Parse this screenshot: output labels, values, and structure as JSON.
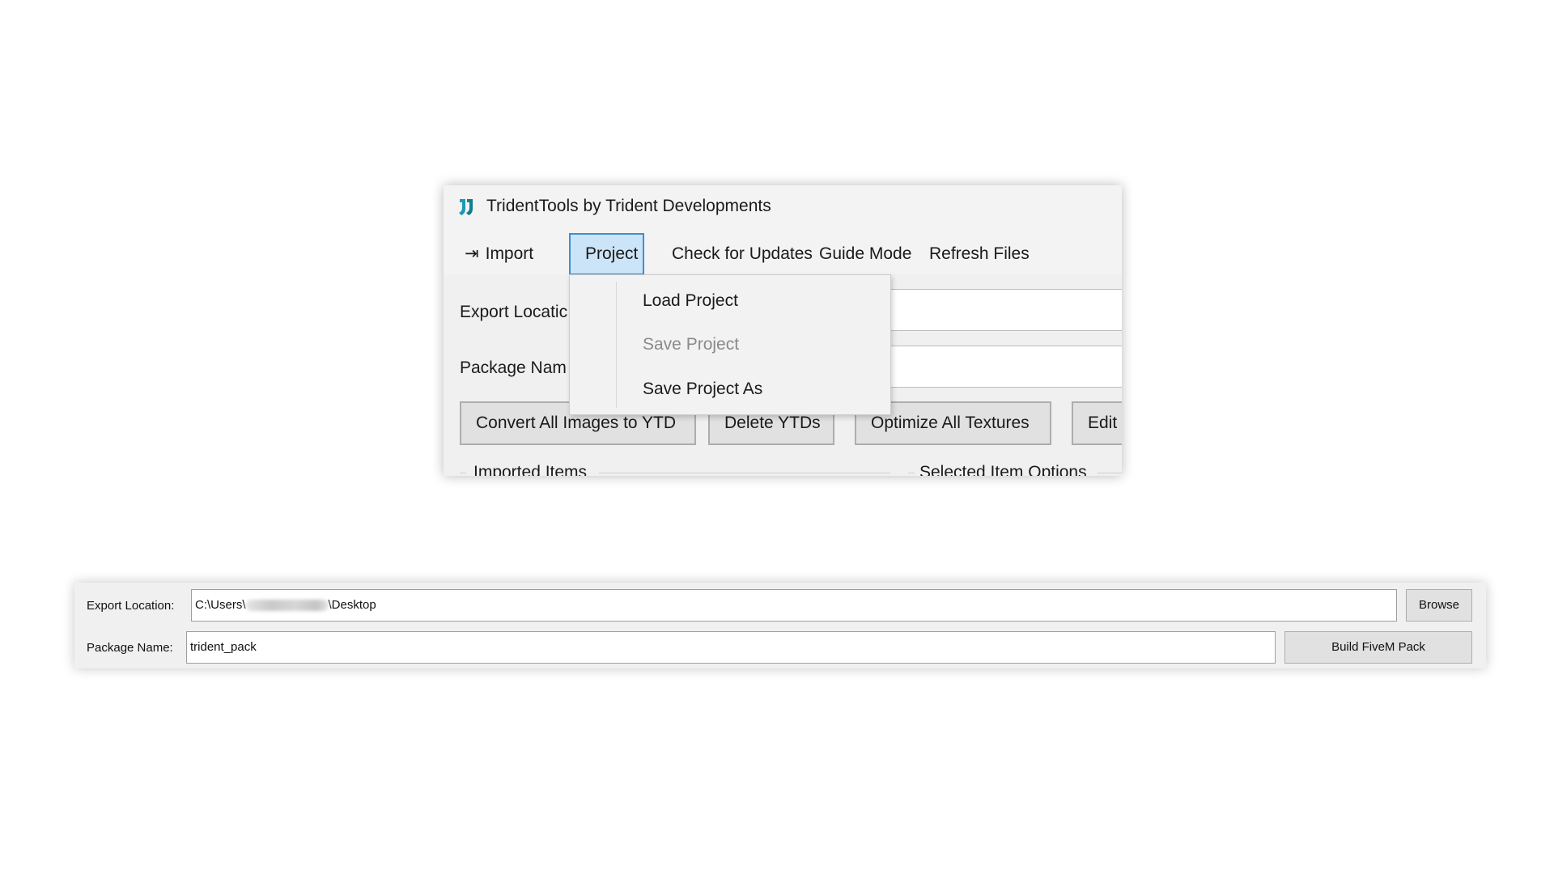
{
  "window": {
    "title": "TridentTools by Trident Developments",
    "icon": "trident-logo-icon"
  },
  "menubar": {
    "import_label": "Import",
    "import_icon": "arrow-to-line-icon",
    "project_label": "Project",
    "updates_label": "Check for Updates",
    "guide_label": "Guide Mode",
    "refresh_label": "Refresh Files"
  },
  "project_menu": {
    "items": [
      {
        "label": "Load Project",
        "enabled": true
      },
      {
        "label": "Save Project",
        "enabled": false
      },
      {
        "label": "Save Project As",
        "enabled": true
      }
    ]
  },
  "form": {
    "export_label_partial": "Export Locatic",
    "package_label_partial": "Package Nam"
  },
  "actions": {
    "convert_label": "Convert All Images to YTD",
    "delete_label": "Delete YTDs",
    "optimize_label": "Optimize All Textures",
    "edit_label_partial": "Edit"
  },
  "groups": {
    "imported_label": "Imported Items",
    "selected_label": "Selected Item Options"
  },
  "panel": {
    "export_label": "Export Location:",
    "export_prefix": "C:\\Users\\",
    "export_suffix": "\\Desktop",
    "browse_label": "Browse",
    "package_label": "Package Name:",
    "package_value": "trident_pack",
    "build_label": "Build FiveM Pack"
  },
  "colors": {
    "menu_active_bg": "#cce4f7",
    "menu_active_border": "#3c8ed6",
    "icon_teal": "#1a9bb3"
  }
}
